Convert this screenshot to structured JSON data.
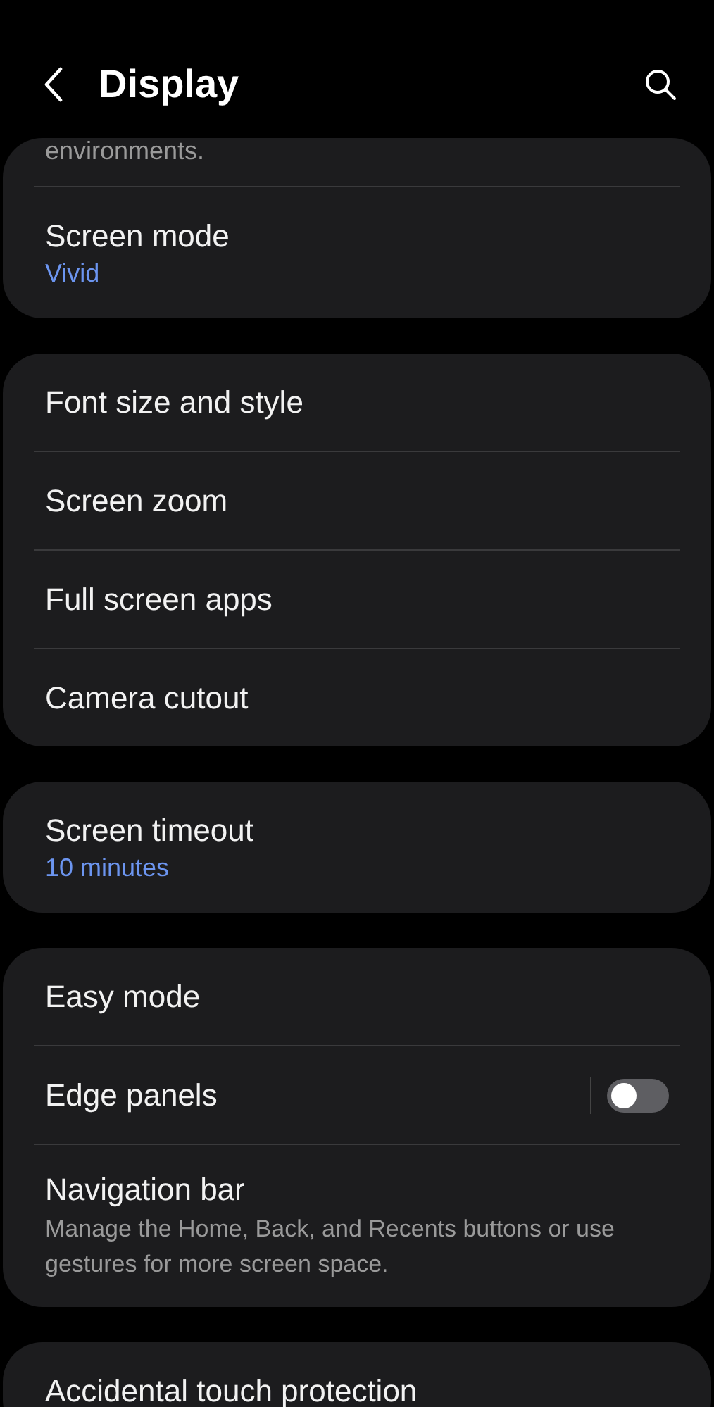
{
  "header": {
    "title": "Display"
  },
  "cards": [
    {
      "items": [
        {
          "kind": "tail",
          "text": "environments."
        },
        {
          "kind": "value",
          "title": "Screen mode",
          "value": "Vivid"
        }
      ]
    },
    {
      "items": [
        {
          "kind": "plain",
          "title": "Font size and style"
        },
        {
          "kind": "plain",
          "title": "Screen zoom"
        },
        {
          "kind": "plain",
          "title": "Full screen apps"
        },
        {
          "kind": "plain",
          "title": "Camera cutout"
        }
      ]
    },
    {
      "items": [
        {
          "kind": "value",
          "title": "Screen timeout",
          "value": "10 minutes"
        }
      ]
    },
    {
      "items": [
        {
          "kind": "plain",
          "title": "Easy mode"
        },
        {
          "kind": "toggle",
          "title": "Edge panels",
          "on": false
        },
        {
          "kind": "description",
          "title": "Navigation bar",
          "description": "Manage the Home, Back, and Recents buttons or use gestures for more screen space."
        }
      ]
    },
    {
      "items": [
        {
          "kind": "plain",
          "title": "Accidental touch protection"
        }
      ]
    }
  ]
}
